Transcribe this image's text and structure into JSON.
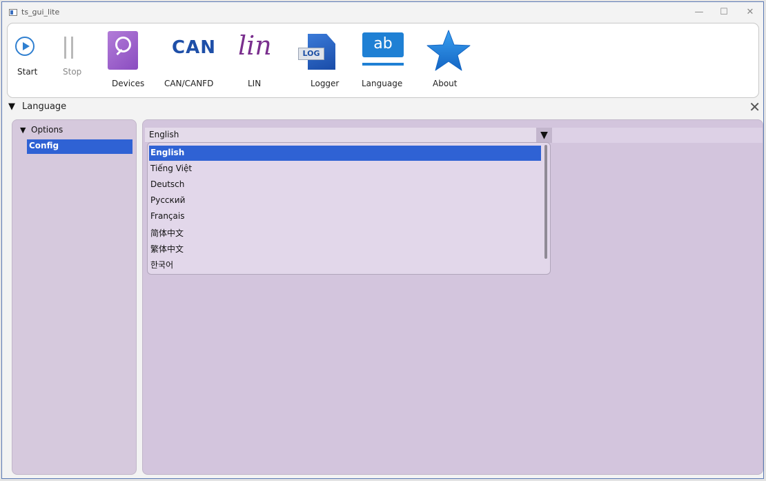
{
  "window": {
    "title": "ts_gui_lite",
    "controls": [
      "—",
      "☐",
      "✕"
    ]
  },
  "toolbar": {
    "items": [
      {
        "label": "Start",
        "icon": "play-circle-icon"
      },
      {
        "label": "Stop",
        "icon": "pause-icon"
      },
      {
        "label": "Devices",
        "icon": "search-icon"
      },
      {
        "label": "CAN/CANFD",
        "icon": "can-icon",
        "icon_text": "CAN"
      },
      {
        "label": "LIN",
        "icon": "lin-icon",
        "icon_text": "lin"
      },
      {
        "label": "Logger",
        "icon": "log-file-icon",
        "icon_text": "LOG"
      },
      {
        "label": "Language",
        "icon": "language-ab-icon",
        "icon_text": "ab"
      },
      {
        "label": "About",
        "icon": "star-icon"
      }
    ],
    "colors": {
      "accent": "#2f7fd0",
      "can": "#1e4fa8",
      "lin": "#7a2f8e",
      "devices": "#9a5cc8"
    }
  },
  "dock": {
    "title": "Language",
    "collapse_glyph": "▼",
    "close_glyph": "✕"
  },
  "tree": {
    "group": {
      "label": "Options",
      "expand_glyph": "▼"
    },
    "items": [
      {
        "label": "Config",
        "selected": true
      }
    ]
  },
  "language_combo": {
    "value": "English",
    "arrow_glyph": "▼",
    "options": [
      "English",
      "Tiếng Việt",
      "Deutsch",
      "Русский",
      "Français",
      "简体中文",
      "繁体中文",
      "한국어"
    ],
    "selected_index": 0,
    "selection_color": "#2f62d4",
    "panel_color": "#d3c5dd"
  }
}
